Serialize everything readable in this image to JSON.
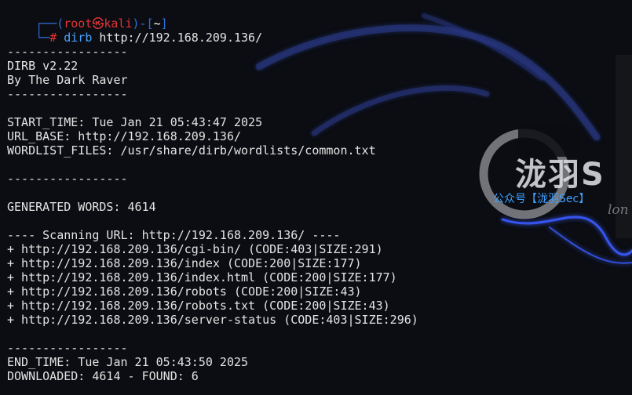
{
  "prompt": {
    "top_left": "┌──(",
    "user": "root㉿kali",
    "mid": ")-[",
    "dir": "~",
    "end": "]",
    "bottom_left": "└─",
    "symbol": "#",
    "command": "dirb",
    "argument": " http://192.168.209.136/"
  },
  "output_lines": [
    "",
    "-----------------",
    "DIRB v2.22",
    "By The Dark Raver",
    "-----------------",
    "",
    "START_TIME: Tue Jan 21 05:43:47 2025",
    "URL_BASE: http://192.168.209.136/",
    "WORDLIST_FILES: /usr/share/dirb/wordlists/common.txt",
    "",
    "-----------------",
    "",
    "GENERATED WORDS: 4614",
    "",
    "---- Scanning URL: http://192.168.209.136/ ----",
    "+ http://192.168.209.136/cgi-bin/ (CODE:403|SIZE:291)",
    "+ http://192.168.209.136/index (CODE:200|SIZE:177)",
    "+ http://192.168.209.136/index.html (CODE:200|SIZE:177)",
    "+ http://192.168.209.136/robots (CODE:200|SIZE:43)",
    "+ http://192.168.209.136/robots.txt (CODE:200|SIZE:43)",
    "+ http://192.168.209.136/server-status (CODE:403|SIZE:296)",
    "",
    "-----------------",
    "END_TIME: Tue Jan 21 05:43:50 2025",
    "DOWNLOADED: 4614 - FOUND: 6"
  ],
  "watermark": {
    "title": "泷羽S",
    "subtitle": "公众号【泷羽Sec】",
    "script_text": "lon"
  },
  "colors": {
    "background": "#0b0d12",
    "text": "#e4e4e4",
    "prompt_blue": "#2e6fd8",
    "prompt_red": "#e03434",
    "command_blue": "#4aa3ff",
    "dragon_glow": "#3b5bff"
  }
}
